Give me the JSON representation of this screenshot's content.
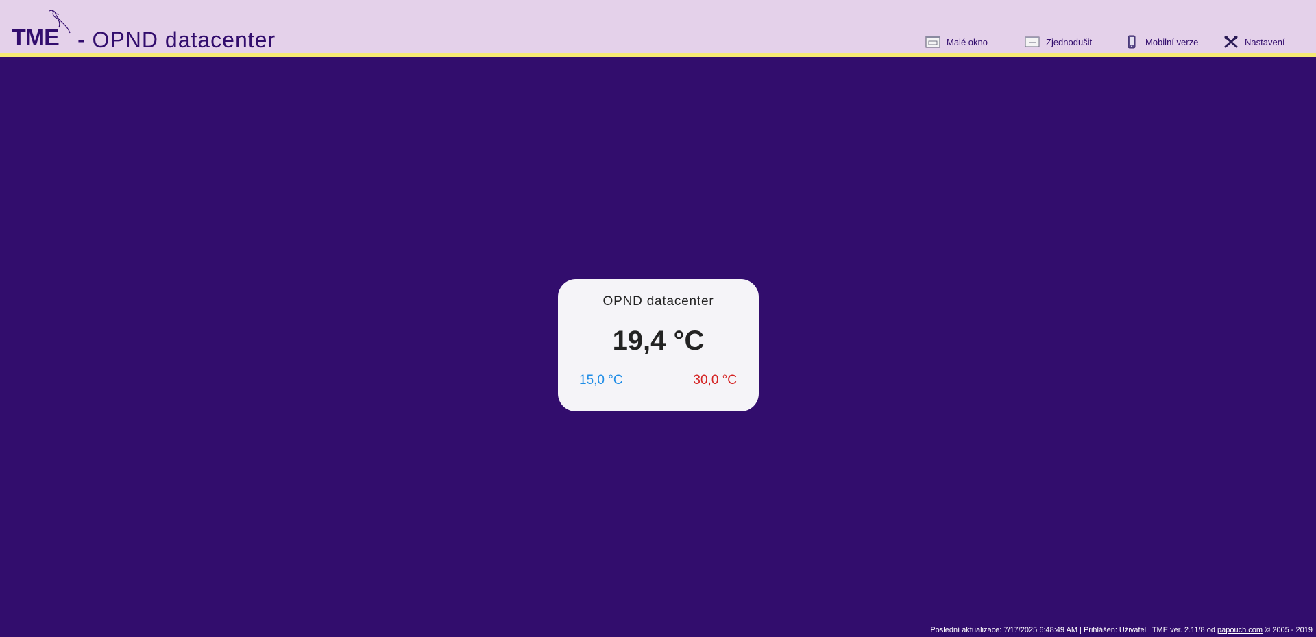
{
  "header": {
    "logo_text": "TME",
    "title": "- OPND datacenter"
  },
  "nav": [
    {
      "label": "Malé okno",
      "icon": "small-window-icon"
    },
    {
      "label": "Zjednodušit",
      "icon": "simplify-icon"
    },
    {
      "label": "Mobilní verze",
      "icon": "mobile-icon"
    },
    {
      "label": "Nastavení",
      "icon": "settings-tools-icon"
    }
  ],
  "sensor": {
    "name": "OPND datacenter",
    "value": "19,4 °C",
    "min": "15,0 °C",
    "max": "30,0 °C"
  },
  "footer": {
    "text_before": "Poslední aktualizace: 7/17/2025 6:48:49 AM | Přihlášen: Uživatel | TME ver. 2.11/8 od ",
    "link": "papouch.com",
    "text_after": " © 2005 - 2019"
  },
  "colors": {
    "background": "#320d6d",
    "header": "#e4d1ea",
    "accent_line": "#f6ea74",
    "min_color": "#1e8ce6",
    "max_color": "#d42222"
  }
}
